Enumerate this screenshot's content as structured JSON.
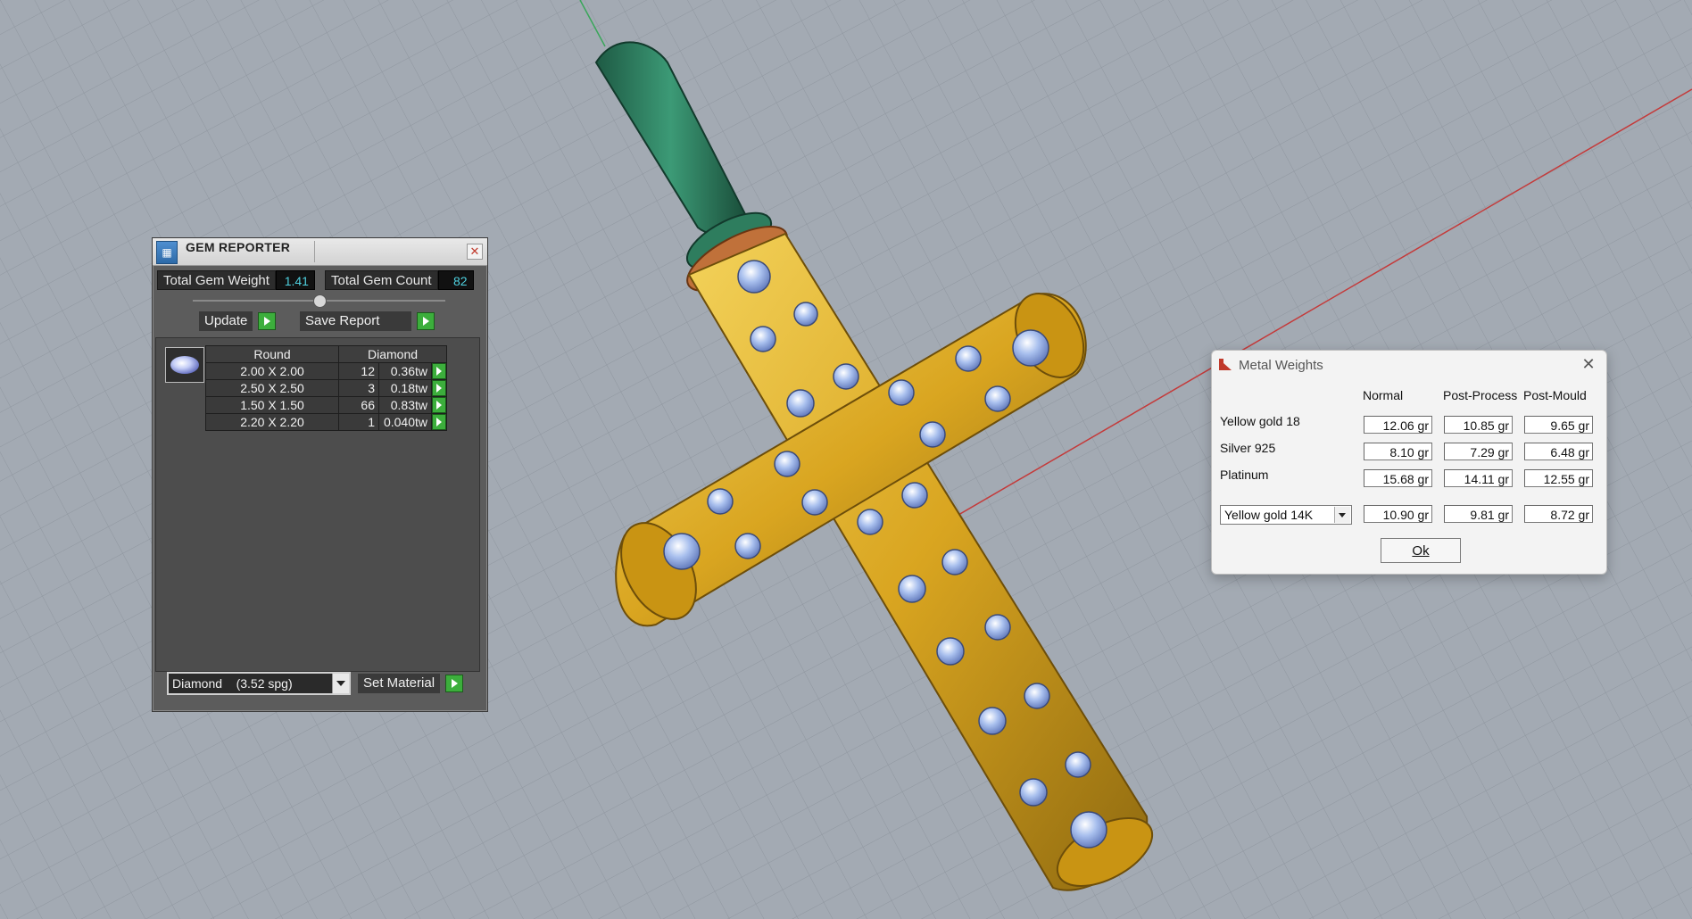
{
  "gem_reporter": {
    "title": "GEM REPORTER",
    "total_gem_weight_label": "Total Gem Weight",
    "total_gem_weight_value": "1.41",
    "total_gem_count_label": "Total Gem Count",
    "total_gem_count_value": "82",
    "update_label": "Update",
    "save_report_label": "Save Report",
    "table_headers": [
      "Round",
      "Diamond"
    ],
    "rows": [
      {
        "size": "2.00 X 2.00",
        "count": "12",
        "weight": "0.36tw"
      },
      {
        "size": "2.50 X 2.50",
        "count": "3",
        "weight": "0.18tw"
      },
      {
        "size": "1.50 X 1.50",
        "count": "66",
        "weight": "0.83tw"
      },
      {
        "size": "2.20 X 2.20",
        "count": "1",
        "weight": "0.040tw"
      }
    ],
    "material_select": "Diamond    (3.52 spg)",
    "set_material_label": "Set Material"
  },
  "metal_weights": {
    "title": "Metal Weights",
    "columns": [
      "Normal",
      "Post-Process",
      "Post-Mould"
    ],
    "rows": [
      {
        "label": "Yellow gold 18",
        "values": [
          "12.06 gr",
          "10.85 gr",
          "9.65 gr"
        ]
      },
      {
        "label": "Silver 925",
        "values": [
          "8.10 gr",
          "7.29 gr",
          "6.48 gr"
        ]
      },
      {
        "label": "Platinum",
        "values": [
          "15.68 gr",
          "14.11 gr",
          "12.55 gr"
        ]
      }
    ],
    "custom_select": "Yellow gold 14K",
    "custom_values": [
      "10.90 gr",
      "9.81 gr",
      "8.72 gr"
    ],
    "ok_label": "Ok"
  },
  "colors": {
    "viewport_bg": "#a3aab3",
    "grid_line": "#8f969f",
    "axis_red": "#c43a3a",
    "axis_green": "#3aa65a",
    "gold": "#d9a520",
    "bail_green": "#2e7d5e",
    "gem_blue": "#9fb8e8",
    "value_cyan": "#4fd1e0",
    "go_green": "#3cae3c"
  },
  "icons": [
    "gem-reporter-app-icon",
    "close-icon",
    "play-arrow-icon",
    "dropdown-arrow-icon",
    "metal-weights-app-icon",
    "gem-thumbnail-icon"
  ]
}
